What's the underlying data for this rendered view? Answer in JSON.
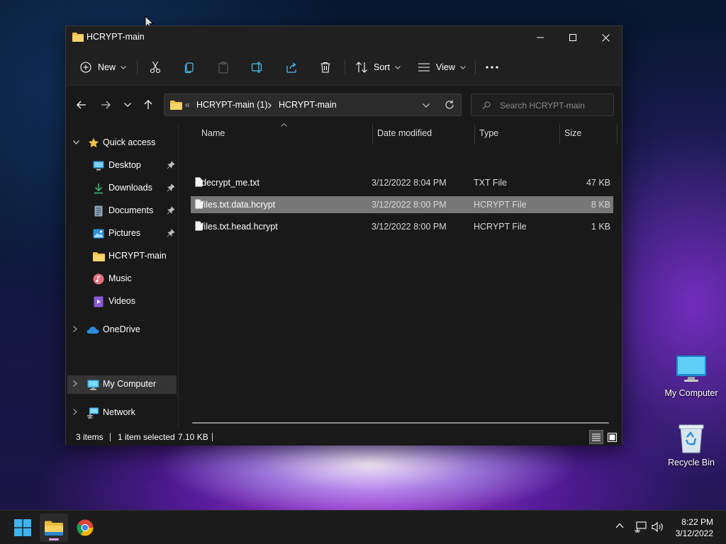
{
  "window": {
    "title": "HCRYPT-main",
    "controls": {
      "minimize": "minimize",
      "maximize": "maximize",
      "close": "close"
    }
  },
  "toolbar": {
    "new_label": "New",
    "sort_label": "Sort",
    "view_label": "View",
    "icons": [
      "cut-icon",
      "copy-icon",
      "paste-icon",
      "rename-icon",
      "share-icon",
      "delete-icon",
      "more-icon"
    ]
  },
  "address": {
    "overflow": "«",
    "crumbs": [
      "HCRYPT-main (1)",
      "HCRYPT-main"
    ],
    "search_placeholder": "Search HCRYPT-main"
  },
  "sidebar": {
    "items": [
      {
        "label": "Quick access",
        "icon": "star-icon",
        "pinned": false
      },
      {
        "label": "Desktop",
        "icon": "desktop-icon",
        "pinned": true
      },
      {
        "label": "Downloads",
        "icon": "download-icon",
        "pinned": true
      },
      {
        "label": "Documents",
        "icon": "documents-icon",
        "pinned": true
      },
      {
        "label": "Pictures",
        "icon": "pictures-icon",
        "pinned": true
      },
      {
        "label": "HCRYPT-main",
        "icon": "folder-icon",
        "pinned": false
      },
      {
        "label": "Music",
        "icon": "music-icon",
        "pinned": false
      },
      {
        "label": "Videos",
        "icon": "videos-icon",
        "pinned": false
      },
      {
        "label": "OneDrive",
        "icon": "cloud-icon",
        "pinned": false
      },
      {
        "label": "My Computer",
        "icon": "computer-icon",
        "pinned": false,
        "selected": true
      },
      {
        "label": "Network",
        "icon": "network-icon",
        "pinned": false
      }
    ]
  },
  "files": {
    "columns": [
      "Name",
      "Date modified",
      "Type",
      "Size"
    ],
    "rows": [
      {
        "name": "decrypt_me.txt",
        "date": "3/12/2022 8:04 PM",
        "type": "TXT File",
        "size": "47 KB",
        "selected": false
      },
      {
        "name": "files.txt.data.hcrypt",
        "date": "3/12/2022 8:00 PM",
        "type": "HCRYPT File",
        "size": "8 KB",
        "selected": true
      },
      {
        "name": "files.txt.head.hcrypt",
        "date": "3/12/2022 8:00 PM",
        "type": "HCRYPT File",
        "size": "1 KB",
        "selected": false
      }
    ]
  },
  "status": {
    "items_count": "3 items",
    "selection": "1 item selected",
    "selection_size": "7.10 KB"
  },
  "desktop": {
    "icons": [
      {
        "label": "My Computer",
        "icon": "computer-icon"
      },
      {
        "label": "Recycle Bin",
        "icon": "recycle-bin-icon"
      }
    ]
  },
  "taskbar": {
    "apps": [
      "start-icon",
      "file-explorer-icon",
      "chrome-icon"
    ],
    "clock_time": "8:22 PM",
    "clock_date": "3/12/2022"
  },
  "colors": {
    "window_bg": "#191919",
    "selection": "#777777",
    "folder": "#f0c24a",
    "accent": "#4cc2ff"
  }
}
